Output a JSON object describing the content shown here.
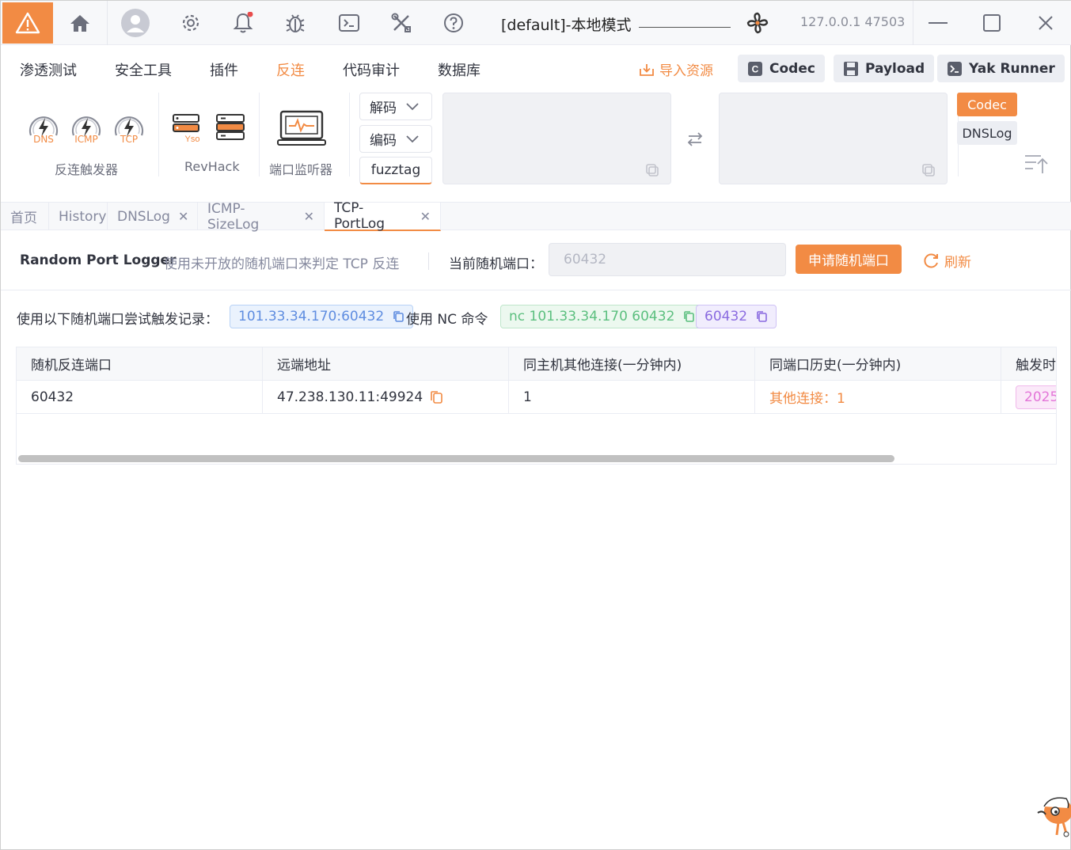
{
  "titlebar": {
    "title": "[default]-本地模式",
    "address": "127.0.0.1 47503"
  },
  "menu": {
    "items": [
      "渗透测试",
      "安全工具",
      "插件",
      "反连",
      "代码审计",
      "数据库"
    ],
    "active": "反连",
    "import_label": "导入资源",
    "buttons": [
      "Codec",
      "Payload",
      "Yak Runner"
    ]
  },
  "tools": {
    "gauges": [
      "DNS",
      "ICMP",
      "TCP"
    ],
    "group_reverse": "反连触发器",
    "yso_label": "Yso",
    "group_revhack": "RevHack",
    "group_portlistener": "端口监听器",
    "decode_label": "解码",
    "encode_label": "编码",
    "fuzztag_label": "fuzztag",
    "side_codec": "Codec",
    "side_dnslog": "DNSLog"
  },
  "tabs": [
    {
      "label": "首页",
      "closable": false
    },
    {
      "label": "History",
      "closable": false
    },
    {
      "label": "DNSLog",
      "closable": true
    },
    {
      "label": "ICMP-SizeLog",
      "closable": true
    },
    {
      "label": "TCP-PortLog",
      "closable": true,
      "active": true
    }
  ],
  "logger": {
    "title": "Random Port Logger",
    "description": "使用未开放的随机端口来判定 TCP 反连",
    "current_label": "当前随机端口：",
    "port_value": "60432",
    "apply_button": "申请随机端口",
    "refresh_label": "刷新"
  },
  "info": {
    "label": "使用以下随机端口尝试触发记录：",
    "address_pill": "101.33.34.170:60432",
    "nc_label": "使用 NC 命令",
    "nc_pill": "nc 101.33.34.170 60432",
    "port_pill": "60432"
  },
  "table": {
    "headers": [
      "随机反连端口",
      "远端地址",
      "同主机其他连接(一分钟内)",
      "同端口历史(一分钟内)",
      "触发时"
    ],
    "rows": [
      {
        "port": "60432",
        "remote": "47.238.130.11:49924",
        "same_host": "1",
        "history": "其他连接：1",
        "time": "2025-"
      }
    ]
  },
  "colors": {
    "accent": "#f28b44",
    "blue_pill": "#5f8de0",
    "green_pill": "#5cbf7f",
    "purple_pill": "#8a6be0"
  }
}
